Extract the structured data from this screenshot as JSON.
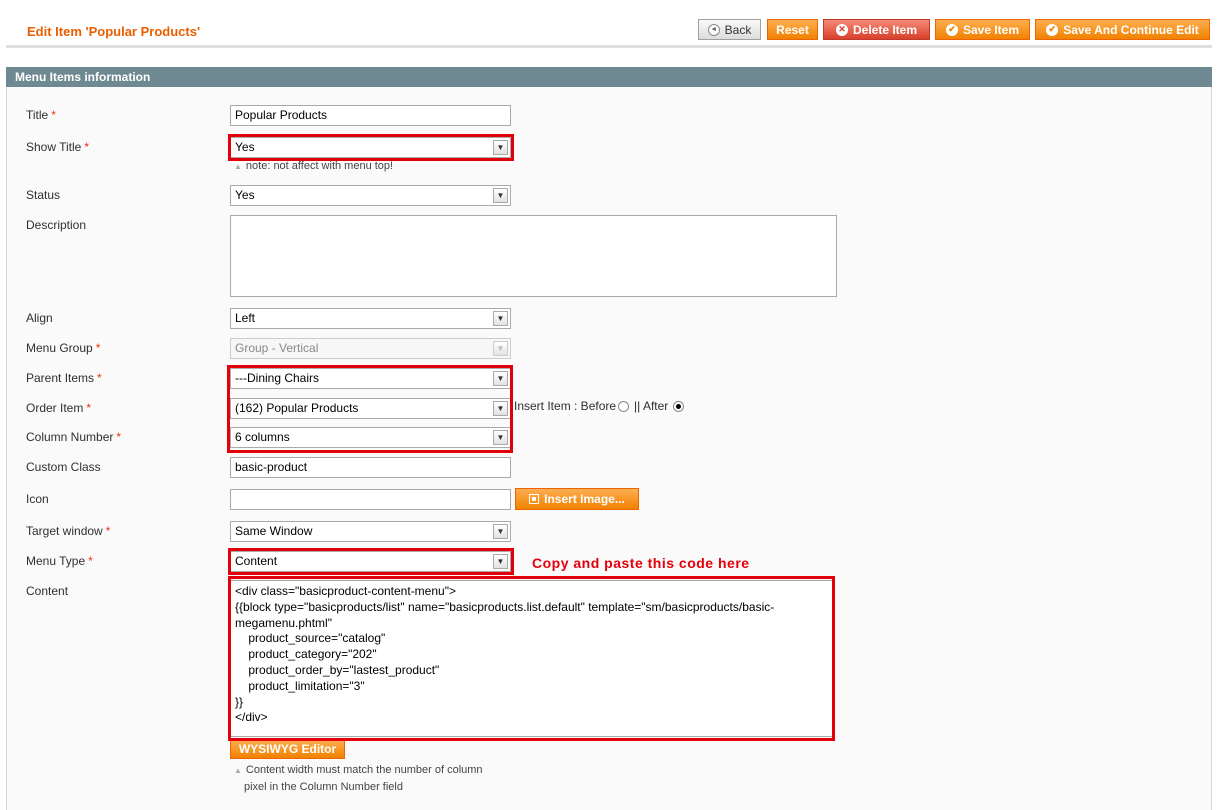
{
  "page_title": "Edit Item 'Popular Products'",
  "buttons": {
    "back": "Back",
    "reset": "Reset",
    "delete": "Delete Item",
    "save": "Save Item",
    "save_continue": "Save And Continue Edit"
  },
  "section_title": "Menu Items information",
  "form": {
    "title": {
      "label": "Title",
      "value": "Popular Products"
    },
    "show_title": {
      "label": "Show Title",
      "value": "Yes",
      "note": "note: not affect with menu top!"
    },
    "status": {
      "label": "Status",
      "value": "Yes"
    },
    "description": {
      "label": "Description",
      "value": ""
    },
    "align": {
      "label": "Align",
      "value": "Left"
    },
    "menu_group": {
      "label": "Menu Group",
      "value": "Group - Vertical"
    },
    "parent_items": {
      "label": "Parent Items",
      "value": "---Dining Chairs"
    },
    "order_item": {
      "label": "Order Item",
      "value": "(162) Popular Products",
      "insert_label": "Insert Item : Before",
      "separator": "|| After",
      "position": "After"
    },
    "column_number": {
      "label": "Column Number",
      "value": "6 columns"
    },
    "custom_class": {
      "label": "Custom Class",
      "value": "basic-product"
    },
    "icon": {
      "label": "Icon",
      "value": "",
      "button": "Insert Image..."
    },
    "target_window": {
      "label": "Target window",
      "value": "Same Window"
    },
    "menu_type": {
      "label": "Menu Type",
      "value": "Content"
    },
    "content": {
      "label": "Content",
      "value": "<div class=\"basicproduct-content-menu\">\n{{block type=\"basicproducts/list\" name=\"basicproducts.list.default\" template=\"sm/basicproducts/basic-megamenu.phtml\"\n\tproduct_source=\"catalog\"\n\tproduct_category=\"202\"\n\tproduct_order_by=\"lastest_product\"\n\tproduct_limitation=\"3\"\n}}\n</div>",
      "wysiwyg_button": "WYSIWYG Editor",
      "note_line1": "Content width must match the number of column",
      "note_line2": "pixel in the Column Number field"
    }
  },
  "annotation": "Copy and paste this code here",
  "colors": {
    "accent": "#eb5e00",
    "section_header": "#6f8992",
    "highlight": "#e3000b",
    "button": "#f18200"
  }
}
